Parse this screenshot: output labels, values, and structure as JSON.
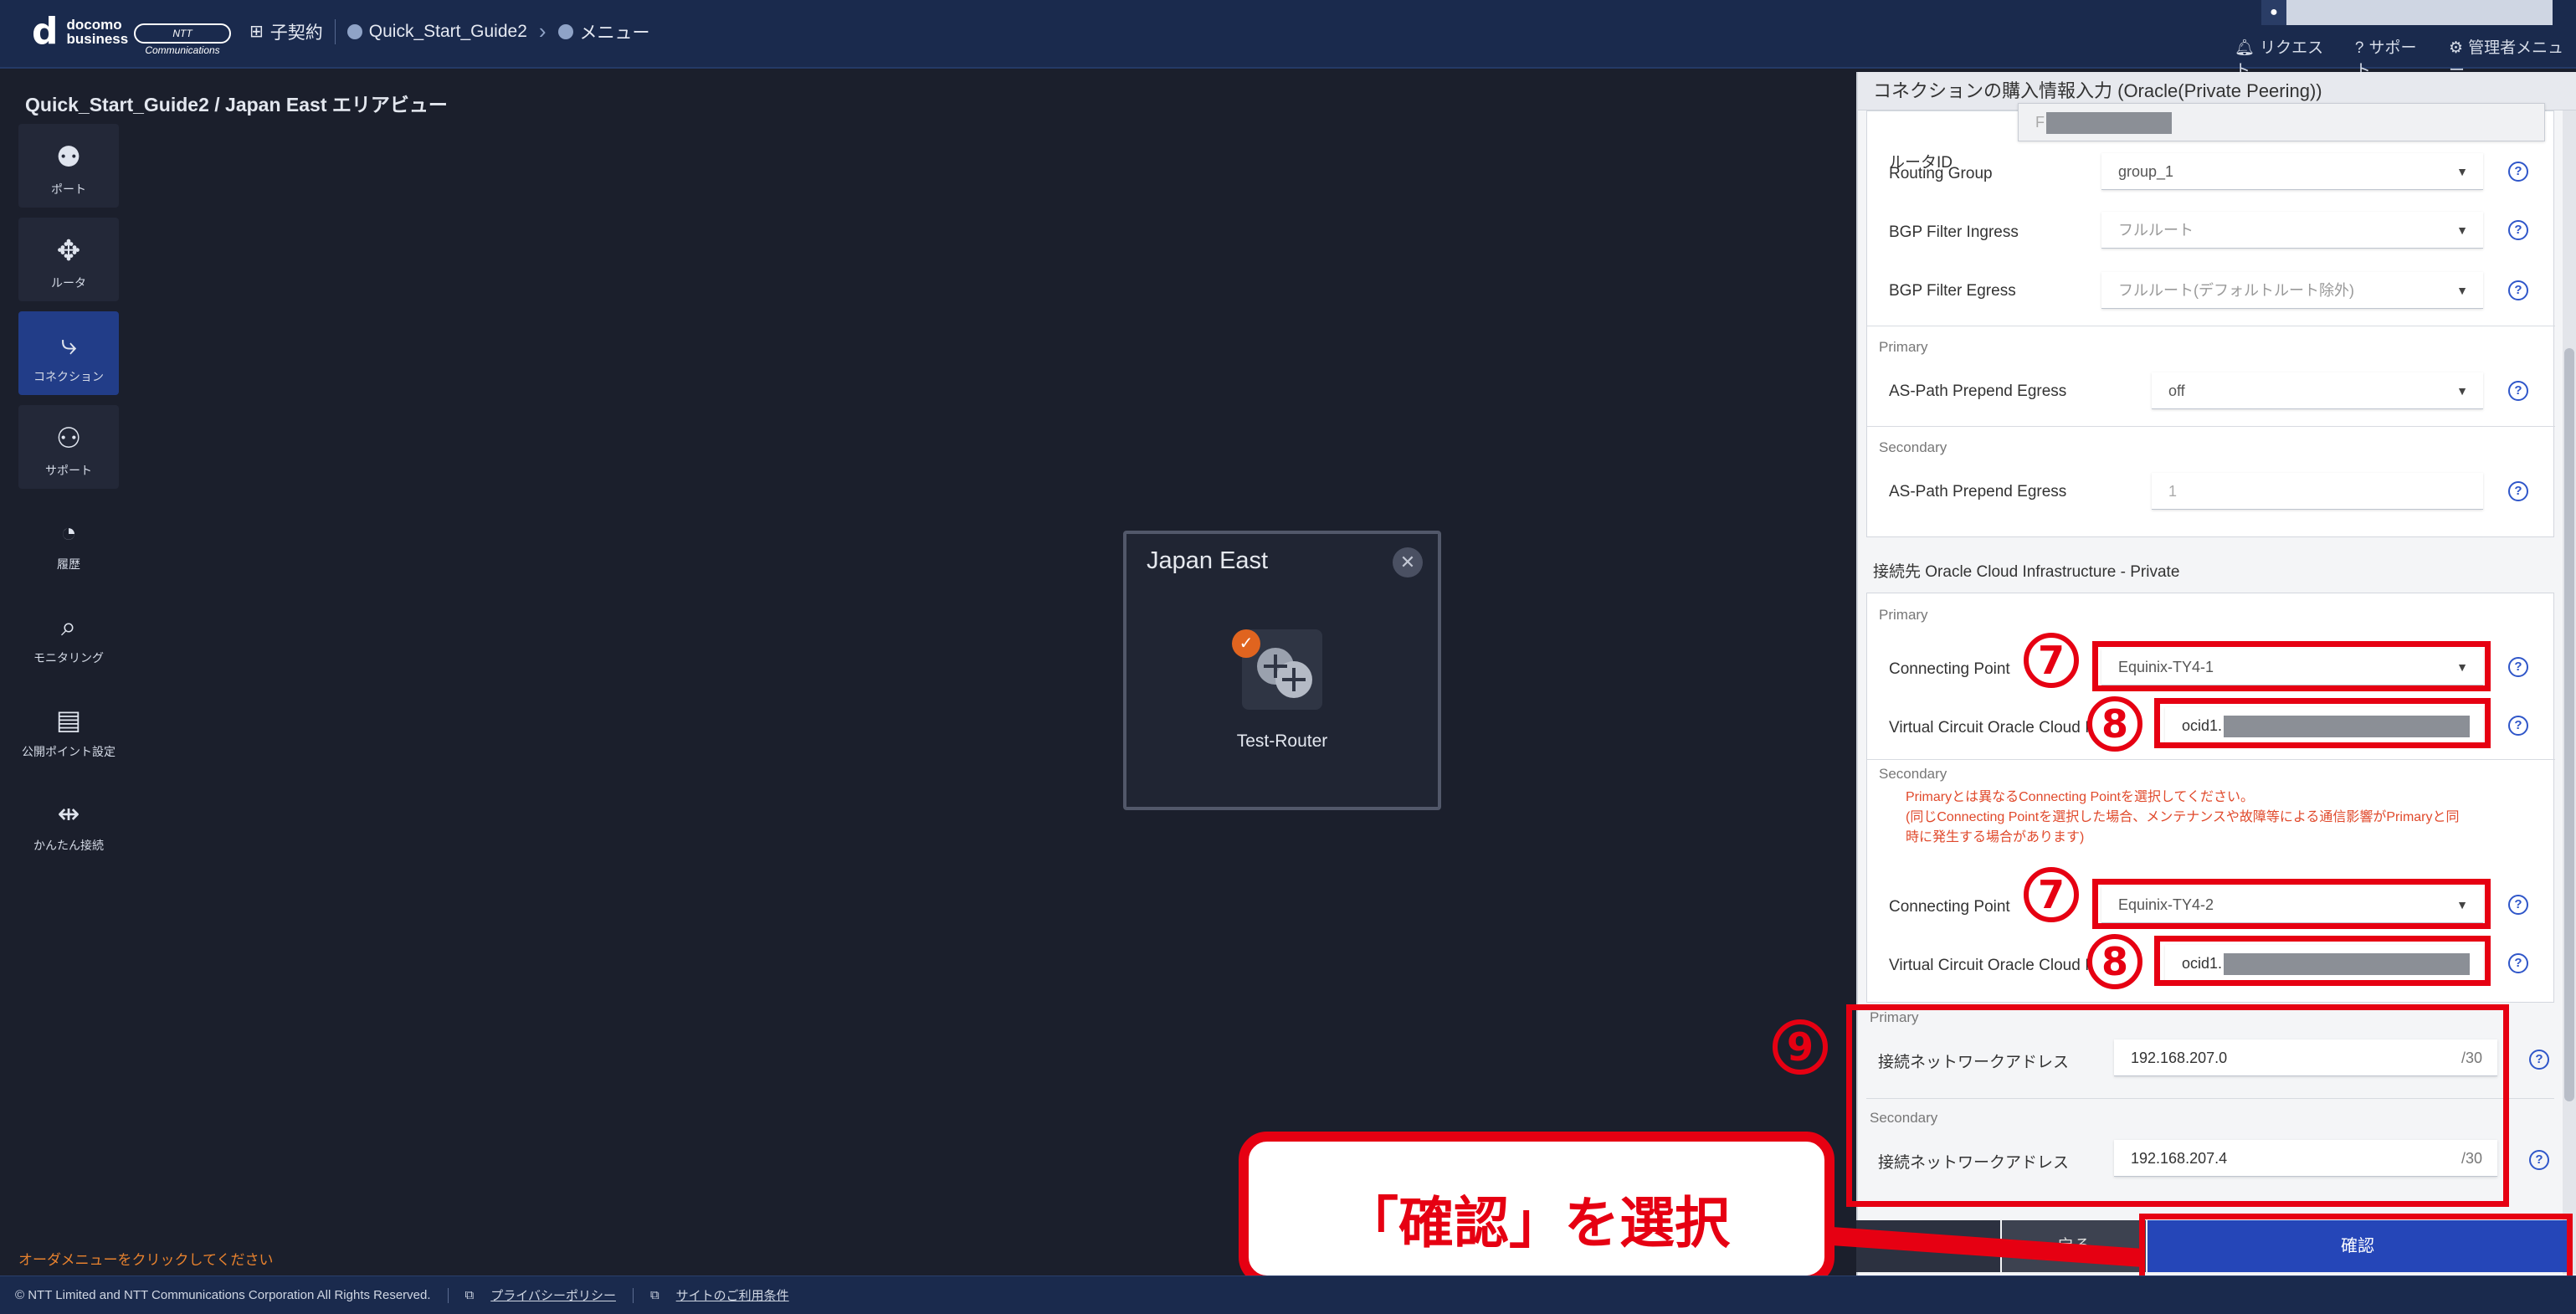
{
  "header": {
    "logo_mark": "d",
    "logo_line1": "docomo",
    "logo_line2": "business",
    "ntt_badge": "NTT Communications",
    "nav": [
      "子契約",
      "Quick_Start_Guide2",
      "メニュー"
    ],
    "links": [
      "リクエスト",
      "サポート",
      "管理者メニュー"
    ]
  },
  "page": {
    "title": "Quick_Start_Guide2 / Japan East エリアビュー",
    "bottom_hint": "オーダメニューをクリックしてください"
  },
  "sidebar": {
    "items": [
      {
        "label": "ポート",
        "icon": "port-icon"
      },
      {
        "label": "ルータ",
        "icon": "router-icon"
      },
      {
        "label": "コネクション",
        "icon": "connection-icon",
        "active": true
      },
      {
        "label": "サポート",
        "icon": "support-icon"
      },
      {
        "label": "履歴",
        "icon": "history-icon"
      },
      {
        "label": "モニタリング",
        "icon": "monitoring-icon"
      },
      {
        "label": "公開ポイント設定",
        "icon": "public-point-icon"
      },
      {
        "label": "かんたん接続",
        "icon": "easy-connect-icon"
      }
    ]
  },
  "area": {
    "title": "Japan East",
    "router_label": "Test-Router"
  },
  "panel": {
    "title": "コネクションの購入情報入力 (Oracle(Private Peering))",
    "router_id_label": "ルータID",
    "router_id_value": "F",
    "routing_group_label": "Routing Group",
    "routing_group_value": "group_1",
    "bgp_in_label": "BGP Filter Ingress",
    "bgp_in_value": "フルルート",
    "bgp_out_label": "BGP Filter Egress",
    "bgp_out_value": "フルルート(デフォルトルート除外)",
    "primary": "Primary",
    "secondary": "Secondary",
    "aspath_label": "AS-Path Prepend Egress",
    "aspath_primary_value": "off",
    "aspath_secondary_value": "1",
    "dest_title": "接続先 Oracle Cloud Infrastructure - Private",
    "cp_label": "Connecting Point",
    "cp_primary": "Equinix-TY4-1",
    "cp_secondary": "Equinix-TY4-2",
    "vc_label": "Virtual Circuit Oracle Cloud ID",
    "vc_value": "ocid1.",
    "warn1": "Primaryとは異なるConnecting Pointを選択してください。",
    "warn2": "(同じConnecting Pointを選択した場合、メンテナンスや故障等による通信影響がPrimaryと同",
    "warn3": "時に発生する場合があります)",
    "net_label": "接続ネットワークアドレス",
    "net_primary": "192.168.207.0",
    "net_secondary": "192.168.207.4",
    "net_suffix": "/30",
    "back_button": "戻る",
    "confirm_button": "確認"
  },
  "annotations": {
    "num7": "7",
    "num8": "8",
    "num9": "9",
    "callout": "「確認」を選択"
  },
  "footer": {
    "copyright": "© NTT Limited and NTT Communications Corporation All Rights Reserved.",
    "privacy": "プライバシーポリシー",
    "terms": "サイトのご利用条件"
  }
}
